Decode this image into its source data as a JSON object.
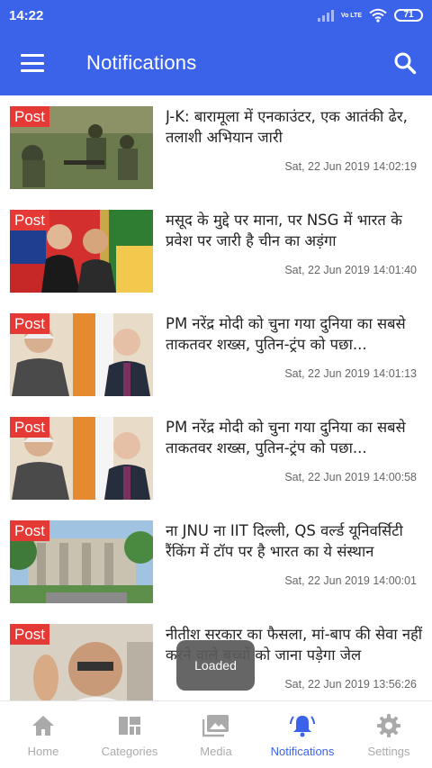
{
  "status_bar": {
    "time": "14:22",
    "network": "Vo LTE",
    "battery": "71"
  },
  "app_bar": {
    "title": "Notifications"
  },
  "notifications": [
    {
      "badge": "Post",
      "title": "J-K: बारामूला में एनकाउंटर, एक आतंकी ढेर, तलाशी अभियान जारी",
      "date": "Sat, 22 Jun 2019 14:02:19"
    },
    {
      "badge": "Post",
      "title": "मसूद के मुद्दे पर माना, पर NSG में भारत के प्रवेश पर जारी है चीन का अड़ंगा",
      "date": "Sat, 22 Jun 2019 14:01:40"
    },
    {
      "badge": "Post",
      "title": "PM नरेंद्र मोदी को चुना गया दुनिया का सबसे ताकतवर शख्स, पुतिन-ट्रंप को पछा...",
      "date": "Sat, 22 Jun 2019 14:01:13"
    },
    {
      "badge": "Post",
      "title": "PM नरेंद्र मोदी को चुना गया दुनिया का सबसे ताकतवर शख्स, पुतिन-ट्रंप को पछा...",
      "date": "Sat, 22 Jun 2019 14:00:58"
    },
    {
      "badge": "Post",
      "title": "ना JNU ना IIT दिल्ली, QS वर्ल्ड यूनिवर्सिटी रैंकिंग में टॉप पर है भारत का ये संस्थान",
      "date": "Sat, 22 Jun 2019 14:00:01"
    },
    {
      "badge": "Post",
      "title": "नीतीश सरकार का फैसला, मां-बाप की सेवा नहीं करने वाले बच्चों को जाना पड़ेगा जेल",
      "date": "Sat, 22 Jun 2019 13:56:26"
    }
  ],
  "toast": {
    "text": "Loaded"
  },
  "bottom_nav": {
    "items": [
      {
        "label": "Home",
        "icon": "home-icon"
      },
      {
        "label": "Categories",
        "icon": "categories-icon"
      },
      {
        "label": "Media",
        "icon": "media-icon"
      },
      {
        "label": "Notifications",
        "icon": "bell-icon",
        "active": true
      },
      {
        "label": "Settings",
        "icon": "gear-icon"
      }
    ]
  },
  "colors": {
    "primary": "#3b63ea",
    "badge": "#e53935",
    "inactive": "#aaaaaa"
  }
}
